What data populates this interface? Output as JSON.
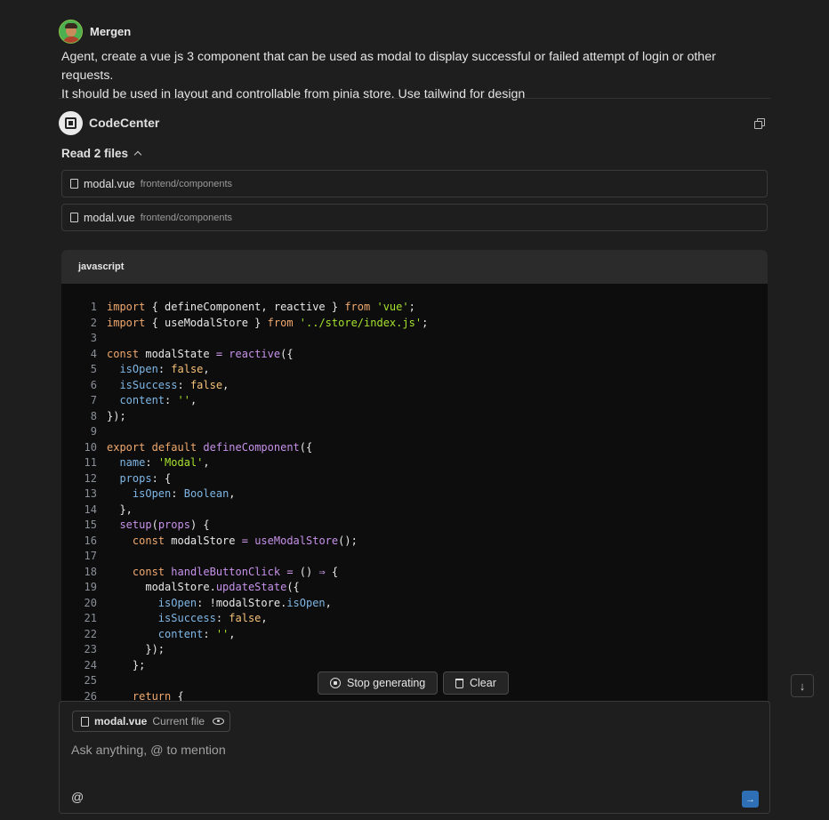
{
  "user_message": {
    "author": "Mergen",
    "line1": "Agent, create a vue js 3 component that can be used as modal to display successful or failed attempt of login or other requests.",
    "line2": "It should be used in layout and controllable from pinia store. Use tailwind for design"
  },
  "agent": {
    "name": "CodeCenter",
    "read_files_label": "Read 2 files",
    "files": [
      {
        "name": "modal.vue",
        "path": "frontend/components"
      },
      {
        "name": "modal.vue",
        "path": "frontend/components"
      }
    ]
  },
  "code_block": {
    "language": "javascript",
    "lines": [
      {
        "n": "1",
        "t": [
          [
            "kw",
            "import"
          ],
          [
            "p",
            " { defineComponent, reactive } "
          ],
          [
            "kw",
            "from"
          ],
          [
            "p",
            " "
          ],
          [
            "str",
            "'vue'"
          ],
          [
            "p",
            ";"
          ]
        ]
      },
      {
        "n": "2",
        "t": [
          [
            "kw",
            "import"
          ],
          [
            "p",
            " { useModalStore } "
          ],
          [
            "kw",
            "from"
          ],
          [
            "p",
            " "
          ],
          [
            "str",
            "'../store/index.js'"
          ],
          [
            "p",
            ";"
          ]
        ]
      },
      {
        "n": "3",
        "t": []
      },
      {
        "n": "4",
        "t": [
          [
            "kw",
            "const"
          ],
          [
            "p",
            " modalState "
          ],
          [
            "op",
            "="
          ],
          [
            "p",
            " "
          ],
          [
            "fn",
            "reactive"
          ],
          [
            "p",
            "({"
          ]
        ]
      },
      {
        "n": "5",
        "t": [
          [
            "p",
            "  "
          ],
          [
            "prop",
            "isOpen"
          ],
          [
            "p",
            ": "
          ],
          [
            "num",
            "false"
          ],
          [
            "p",
            ","
          ]
        ]
      },
      {
        "n": "6",
        "t": [
          [
            "p",
            "  "
          ],
          [
            "prop",
            "isSuccess"
          ],
          [
            "p",
            ": "
          ],
          [
            "num",
            "false"
          ],
          [
            "p",
            ","
          ]
        ]
      },
      {
        "n": "7",
        "t": [
          [
            "p",
            "  "
          ],
          [
            "prop",
            "content"
          ],
          [
            "p",
            ": "
          ],
          [
            "str",
            "''"
          ],
          [
            "p",
            ","
          ]
        ]
      },
      {
        "n": "8",
        "t": [
          [
            "p",
            "});"
          ]
        ]
      },
      {
        "n": "9",
        "t": []
      },
      {
        "n": "10",
        "t": [
          [
            "kw",
            "export"
          ],
          [
            "p",
            " "
          ],
          [
            "kw",
            "default"
          ],
          [
            "p",
            " "
          ],
          [
            "fn",
            "defineComponent"
          ],
          [
            "p",
            "({"
          ]
        ]
      },
      {
        "n": "11",
        "t": [
          [
            "p",
            "  "
          ],
          [
            "prop",
            "name"
          ],
          [
            "p",
            ": "
          ],
          [
            "str",
            "'Modal'"
          ],
          [
            "p",
            ","
          ]
        ]
      },
      {
        "n": "12",
        "t": [
          [
            "p",
            "  "
          ],
          [
            "prop",
            "props"
          ],
          [
            "p",
            ": {"
          ]
        ]
      },
      {
        "n": "13",
        "t": [
          [
            "p",
            "    "
          ],
          [
            "prop",
            "isOpen"
          ],
          [
            "p",
            ": "
          ],
          [
            "prop",
            "Boolean"
          ],
          [
            "p",
            ","
          ]
        ]
      },
      {
        "n": "14",
        "t": [
          [
            "p",
            "  },"
          ]
        ]
      },
      {
        "n": "15",
        "t": [
          [
            "p",
            "  "
          ],
          [
            "fn",
            "setup"
          ],
          [
            "p",
            "("
          ],
          [
            "fn",
            "props"
          ],
          [
            "p",
            ") {"
          ]
        ]
      },
      {
        "n": "16",
        "t": [
          [
            "p",
            "    "
          ],
          [
            "kw",
            "const"
          ],
          [
            "p",
            " modalStore "
          ],
          [
            "op",
            "="
          ],
          [
            "p",
            " "
          ],
          [
            "fn",
            "useModalStore"
          ],
          [
            "p",
            "();"
          ]
        ]
      },
      {
        "n": "17",
        "t": []
      },
      {
        "n": "18",
        "t": [
          [
            "p",
            "    "
          ],
          [
            "kw",
            "const"
          ],
          [
            "p",
            " "
          ],
          [
            "fn",
            "handleButtonClick"
          ],
          [
            "p",
            " "
          ],
          [
            "op",
            "="
          ],
          [
            "p",
            " () "
          ],
          [
            "op",
            "⇒"
          ],
          [
            "p",
            " {"
          ]
        ]
      },
      {
        "n": "19",
        "t": [
          [
            "p",
            "      modalStore."
          ],
          [
            "fn",
            "updateState"
          ],
          [
            "p",
            "({"
          ]
        ]
      },
      {
        "n": "20",
        "t": [
          [
            "p",
            "        "
          ],
          [
            "prop",
            "isOpen"
          ],
          [
            "p",
            ": !modalStore."
          ],
          [
            "prop",
            "isOpen"
          ],
          [
            "p",
            ","
          ]
        ]
      },
      {
        "n": "21",
        "t": [
          [
            "p",
            "        "
          ],
          [
            "prop",
            "isSuccess"
          ],
          [
            "p",
            ": "
          ],
          [
            "num",
            "false"
          ],
          [
            "p",
            ","
          ]
        ]
      },
      {
        "n": "22",
        "t": [
          [
            "p",
            "        "
          ],
          [
            "prop",
            "content"
          ],
          [
            "p",
            ": "
          ],
          [
            "str",
            "''"
          ],
          [
            "p",
            ","
          ]
        ]
      },
      {
        "n": "23",
        "t": [
          [
            "p",
            "      });"
          ]
        ]
      },
      {
        "n": "24",
        "t": [
          [
            "p",
            "    };"
          ]
        ]
      },
      {
        "n": "25",
        "t": []
      },
      {
        "n": "26",
        "t": [
          [
            "p",
            "    "
          ],
          [
            "kw",
            "return"
          ],
          [
            "p",
            " {"
          ]
        ]
      }
    ]
  },
  "actions": {
    "stop_label": "Stop generating",
    "clear_label": "Clear"
  },
  "input": {
    "context_file": "modal.vue",
    "context_label": "Current file",
    "placeholder": "Ask anything, @ to mention",
    "mention_label": "@"
  }
}
